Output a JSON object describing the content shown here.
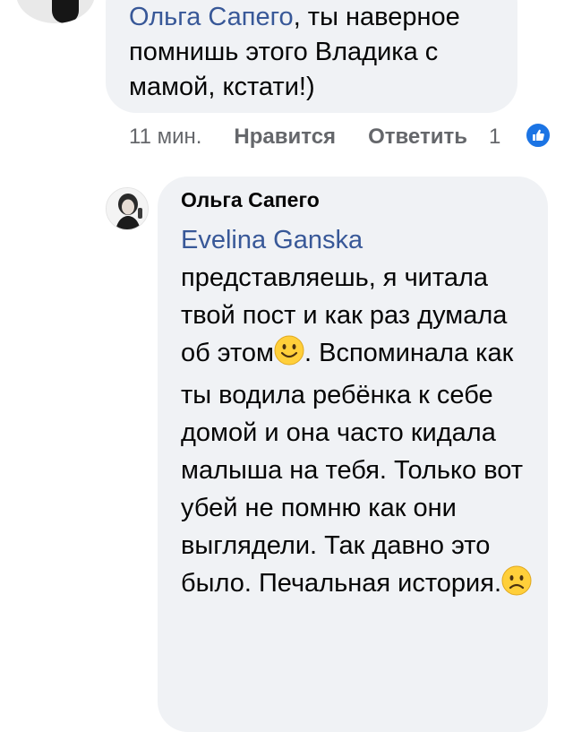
{
  "comment1": {
    "mention": "Ольга Сапего",
    "text": ", ты наверное помнишь этого Владика с мамой, кстати!)",
    "time": "11 мин.",
    "like_label": "Нравится",
    "reply_label": "Ответить",
    "reaction_count": "1",
    "reaction_icon": "thumbs-up-icon"
  },
  "reply": {
    "author": "Ольга Сапего",
    "mention": "Evelina Ganska",
    "text_part1": "представляешь, я читала твой пост и как раз думала об этом",
    "emoji1": "smile-emoji",
    "text_part2": ". Вспоминала как ты водила ребёнка к себе домой и она часто кидала малыша на тебя. Только вот убей не помню как они выглядели. Так давно это было. Печальная история.",
    "emoji2": "sad-emoji"
  },
  "colors": {
    "mention": "#385898",
    "bubble": "#f0f2f5",
    "meta": "#65676b",
    "like_badge": "#1b74e4"
  }
}
